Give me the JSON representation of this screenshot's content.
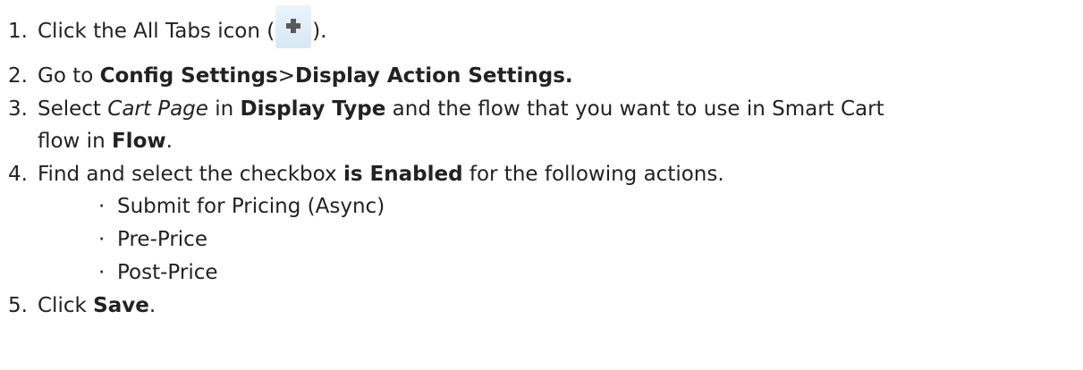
{
  "steps": [
    {
      "num": "1.",
      "text_before": "Click the All Tabs icon (",
      "icon": "all-tabs-plus-icon",
      "text_after": ")."
    },
    {
      "num": "2.",
      "text_before": "Go to ",
      "bold1": "Config Settings",
      "sep": ">",
      "bold2": "Display Action Settings."
    },
    {
      "num": "3.",
      "text_before": "Select ",
      "italic": "Cart Page",
      "text_mid1": " in ",
      "bold1": "Display Type",
      "text_mid2": " and the flow that you want to use in Smart Cart",
      "line2_before": "flow in ",
      "bold2": "Flow",
      "line2_after": "."
    },
    {
      "num": "4.",
      "text_before": "Find and select the checkbox ",
      "bold1": "is Enabled",
      "text_after": " for the following actions.",
      "items": [
        "Submit for Pricing (Async)",
        "Pre-Price",
        "Post-Price"
      ]
    },
    {
      "num": "5.",
      "text_before": "Click ",
      "bold1": "Save",
      "text_after": "."
    }
  ],
  "bullet": "·"
}
